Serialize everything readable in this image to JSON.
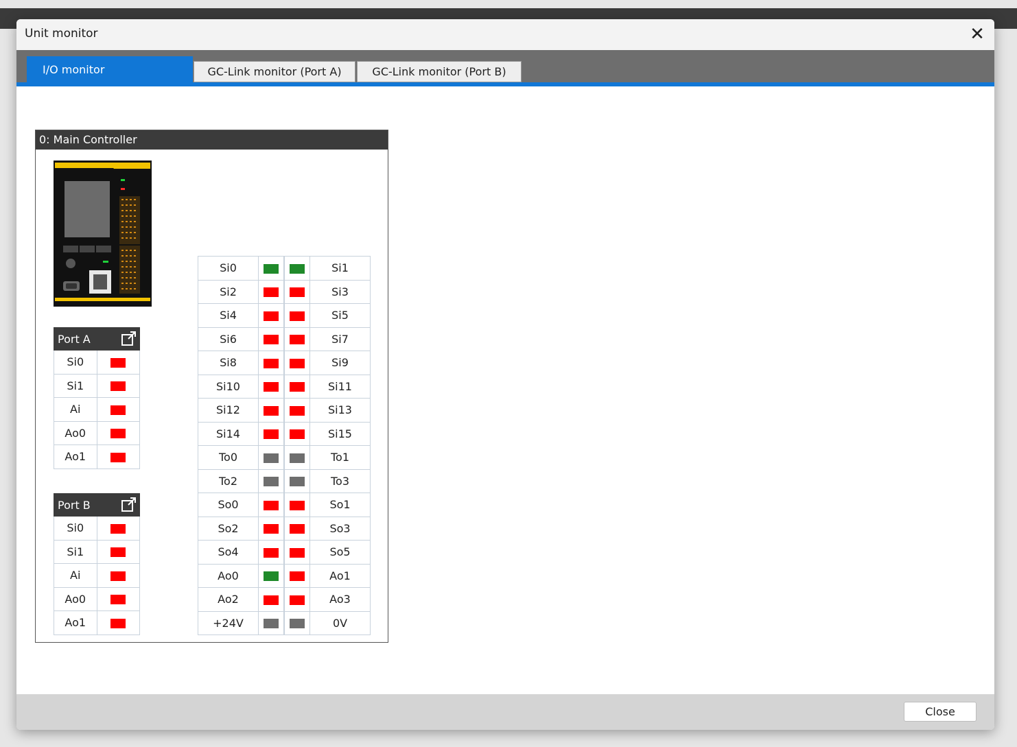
{
  "window": {
    "title": "Unit monitor"
  },
  "tabs": [
    {
      "label": "I/O monitor",
      "active": true
    },
    {
      "label": "GC-Link monitor (Port A)",
      "active": false
    },
    {
      "label": "GC-Link monitor (Port B)",
      "active": false
    }
  ],
  "panel": {
    "title": "0: Main Controller"
  },
  "colors": {
    "on": "#1f8a2a",
    "off": "#ff0000",
    "inactive": "#6e6e6e",
    "accent": "#1177d6"
  },
  "port_a": {
    "title": "Port A",
    "rows": [
      {
        "label": "Si0",
        "state": "off"
      },
      {
        "label": "Si1",
        "state": "off"
      },
      {
        "label": "Ai",
        "state": "off"
      },
      {
        "label": "Ao0",
        "state": "off"
      },
      {
        "label": "Ao1",
        "state": "off"
      }
    ]
  },
  "port_b": {
    "title": "Port B",
    "rows": [
      {
        "label": "Si0",
        "state": "off"
      },
      {
        "label": "Si1",
        "state": "off"
      },
      {
        "label": "Ai",
        "state": "off"
      },
      {
        "label": "Ao0",
        "state": "off"
      },
      {
        "label": "Ao1",
        "state": "off"
      }
    ]
  },
  "io": [
    {
      "left": "Si0",
      "left_state": "on",
      "right": "Si1",
      "right_state": "on"
    },
    {
      "left": "Si2",
      "left_state": "off",
      "right": "Si3",
      "right_state": "off"
    },
    {
      "left": "Si4",
      "left_state": "off",
      "right": "Si5",
      "right_state": "off"
    },
    {
      "left": "Si6",
      "left_state": "off",
      "right": "Si7",
      "right_state": "off"
    },
    {
      "left": "Si8",
      "left_state": "off",
      "right": "Si9",
      "right_state": "off"
    },
    {
      "left": "Si10",
      "left_state": "off",
      "right": "Si11",
      "right_state": "off"
    },
    {
      "left": "Si12",
      "left_state": "off",
      "right": "Si13",
      "right_state": "off"
    },
    {
      "left": "Si14",
      "left_state": "off",
      "right": "Si15",
      "right_state": "off"
    },
    {
      "left": "To0",
      "left_state": "inactive",
      "right": "To1",
      "right_state": "inactive"
    },
    {
      "left": "To2",
      "left_state": "inactive",
      "right": "To3",
      "right_state": "inactive"
    },
    {
      "left": "So0",
      "left_state": "off",
      "right": "So1",
      "right_state": "off"
    },
    {
      "left": "So2",
      "left_state": "off",
      "right": "So3",
      "right_state": "off"
    },
    {
      "left": "So4",
      "left_state": "off",
      "right": "So5",
      "right_state": "off"
    },
    {
      "left": "Ao0",
      "left_state": "on",
      "right": "Ao1",
      "right_state": "off"
    },
    {
      "left": "Ao2",
      "left_state": "off",
      "right": "Ao3",
      "right_state": "off"
    },
    {
      "left": "+24V",
      "left_state": "inactive",
      "right": "0V",
      "right_state": "inactive"
    }
  ],
  "footer": {
    "close_label": "Close"
  }
}
